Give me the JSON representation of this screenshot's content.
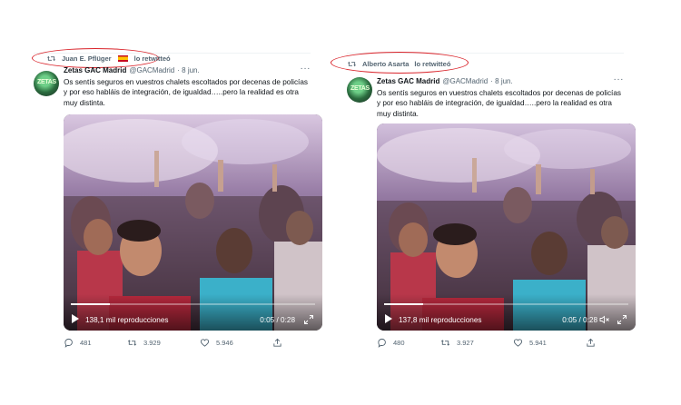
{
  "tweets": [
    {
      "retweeted_by": "Juan E. Pflüger",
      "retweet_suffix": "lo retwitteó",
      "author_name": "Zetas GAC Madrid",
      "author_handle": "@GACMadrid",
      "date": "· 8 jun.",
      "more": "···",
      "text": "Os sentís seguros en vuestros chalets escoltados por decenas de policías y por eso habláis de integración, de igualdad…..pero la realidad es otra muy distinta.",
      "video": {
        "views": "138,1 mil reproducciones",
        "time": "0:05 / 0:28",
        "progress": 0.16,
        "muted": false
      },
      "counts": {
        "replies": "481",
        "retweets": "3.929",
        "likes": "5.946"
      }
    },
    {
      "retweeted_by": "Alberto Asarta",
      "retweet_suffix": "lo retwitteó",
      "author_name": "Zetas GAC Madrid",
      "author_handle": "@GACMadrid",
      "date": "· 8 jun.",
      "more": "···",
      "text": "Os sentís seguros en vuestros chalets escoltados por decenas de policías y por eso habláis de integración, de igualdad…..pero la realidad es otra muy distinta.",
      "video": {
        "views": "137,8 mil reproducciones",
        "time": "0:05 / 0:28",
        "progress": 0.16,
        "muted": true
      },
      "counts": {
        "replies": "480",
        "retweets": "3.927",
        "likes": "5.941"
      }
    }
  ],
  "avatar_text": "ZETAS",
  "icons": [
    "retweet-icon",
    "reply-icon",
    "like-icon",
    "share-icon",
    "play-icon",
    "mute-icon",
    "fullscreen-icon",
    "flag-icon"
  ],
  "colors": {
    "highlight_ellipse": "#d9232a",
    "muted_text": "#536471",
    "text": "#0f1419"
  }
}
